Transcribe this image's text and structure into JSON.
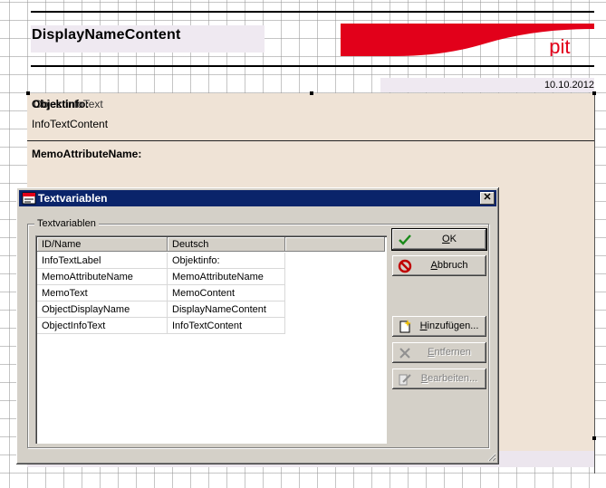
{
  "report": {
    "title": "DisplayNameContent",
    "logo_text": "_pit_",
    "date": "10.10.2012",
    "field_label": "Objektinfo:",
    "field_label_overlap": "ObjectInfoText",
    "field_info": "InfoTextContent",
    "field_memo": "MemoAttributeName:"
  },
  "dialog": {
    "title": "Textvariablen",
    "close": "✕",
    "group_label": "Textvariablen",
    "columns": [
      "ID/Name",
      "Deutsch"
    ],
    "rows": [
      [
        "InfoTextLabel",
        "Objektinfo:"
      ],
      [
        "MemoAttributeName",
        "MemoAttributeName"
      ],
      [
        "MemoText",
        "MemoContent"
      ],
      [
        "ObjectDisplayName",
        "DisplayNameContent"
      ],
      [
        "ObjectInfoText",
        "InfoTextContent"
      ]
    ],
    "buttons": {
      "ok": {
        "pre": "",
        "key": "O",
        "post": "K"
      },
      "cancel": {
        "pre": "",
        "key": "A",
        "post": "bbruch"
      },
      "add": {
        "pre": "",
        "key": "H",
        "post": "inzufügen..."
      },
      "remove": {
        "pre": "",
        "key": "E",
        "post": "ntfernen"
      },
      "edit": {
        "pre": "",
        "key": "B",
        "post": "earbeiten..."
      }
    }
  },
  "colors": {
    "titlebar": "#0a246a",
    "logo_red": "#e2001a",
    "band": "#efe3d6",
    "dialog_face": "#d4d0c8"
  }
}
